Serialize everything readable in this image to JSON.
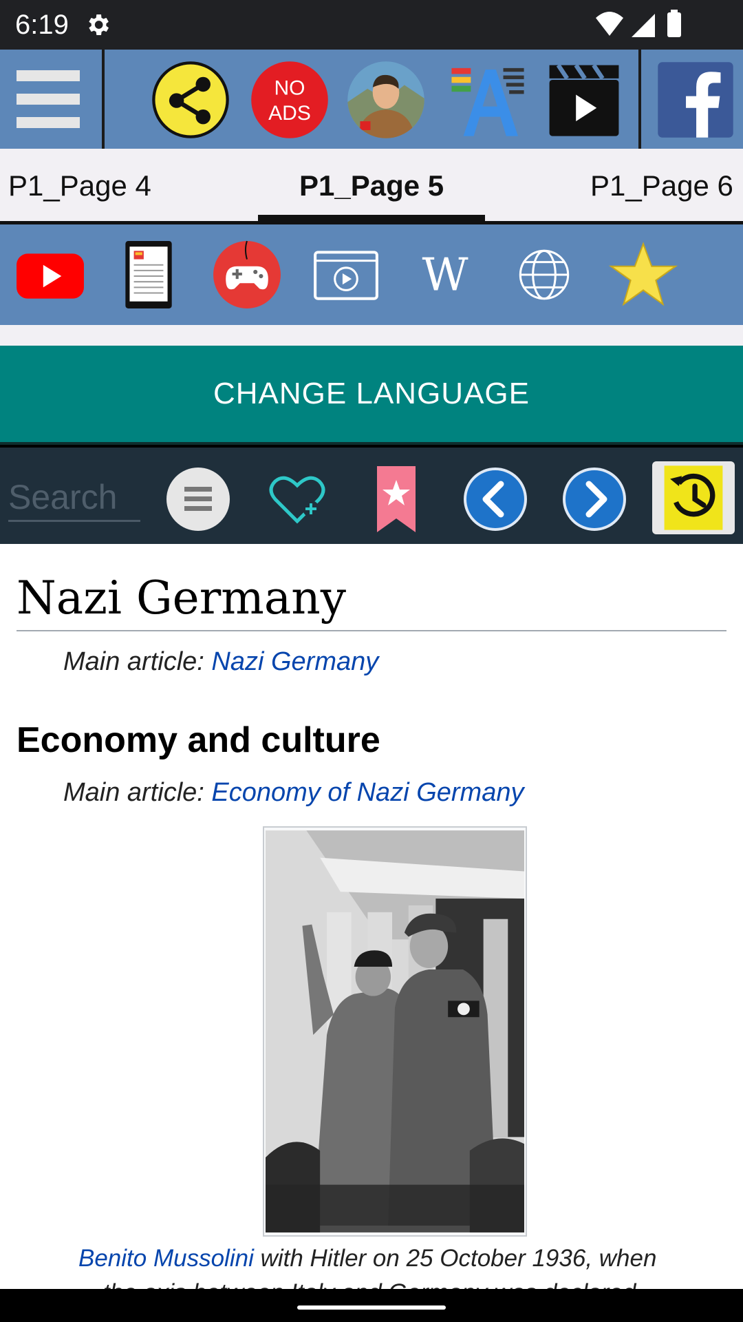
{
  "status_bar": {
    "time": "6:19",
    "icons": [
      "settings-icon",
      "wifi-icon",
      "cell-signal-icon",
      "battery-icon"
    ]
  },
  "toolbar": {
    "icons": [
      "menu-icon",
      "share-icon",
      "no-ads-icon",
      "portrait-icon",
      "font-size-icon",
      "video-clapper-icon",
      "facebook-icon"
    ],
    "no_ads_text_1": "NO",
    "no_ads_text_2": "ADS"
  },
  "tabs": [
    {
      "label": "P1_Page 4",
      "active": false
    },
    {
      "label": "P1_Page 5",
      "active": true
    },
    {
      "label": "P1_Page 6",
      "active": false
    }
  ],
  "quick_bar": {
    "icons": [
      "youtube-icon",
      "ebook-icon",
      "gamepad-icon",
      "video-player-icon",
      "wikipedia-icon",
      "globe-icon",
      "star-icon"
    ]
  },
  "change_language": {
    "label": "CHANGE LANGUAGE"
  },
  "nav_bar": {
    "search_placeholder": "Search",
    "icons": [
      "list-menu-icon",
      "heart-add-icon",
      "bookmark-icon",
      "back-arrow-icon",
      "forward-arrow-icon",
      "history-icon"
    ]
  },
  "article": {
    "title": "Nazi Germany",
    "hatnote1_prefix": "Main article: ",
    "hatnote1_link": "Nazi Germany",
    "section_title": "Economy and culture",
    "hatnote2_prefix": "Main article: ",
    "hatnote2_link": "Economy of Nazi Germany",
    "caption_link": "Benito Mussolini",
    "caption_text": " with Hitler on 25 October 1936, when",
    "caption_line2": "the axis between Italy and Germany was declared"
  },
  "colors": {
    "toolbar_blue": "#5d87b8",
    "teal": "#00837f",
    "nav_dark": "#1f2f3b",
    "link": "#0645ad"
  }
}
